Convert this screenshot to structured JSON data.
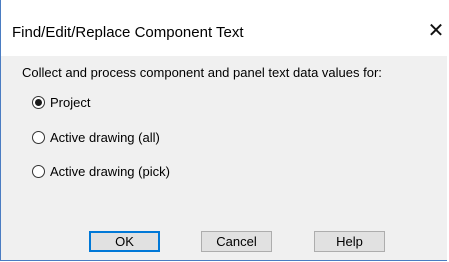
{
  "dialog": {
    "title": "Find/Edit/Replace Component Text",
    "close_glyph": "✕",
    "instructions": "Collect and process component and panel text data values for:",
    "options": [
      {
        "label": "Project",
        "checked": true
      },
      {
        "label": "Active drawing (all)",
        "checked": false
      },
      {
        "label": "Active drawing (pick)",
        "checked": false
      }
    ],
    "buttons": {
      "ok": "OK",
      "cancel": "Cancel",
      "help": "Help"
    }
  },
  "colors": {
    "accent": "#0078d7",
    "window_border": "#4a7cc2",
    "dialog_bg": "#f0f0f0",
    "button_bg": "#e1e1e1"
  }
}
